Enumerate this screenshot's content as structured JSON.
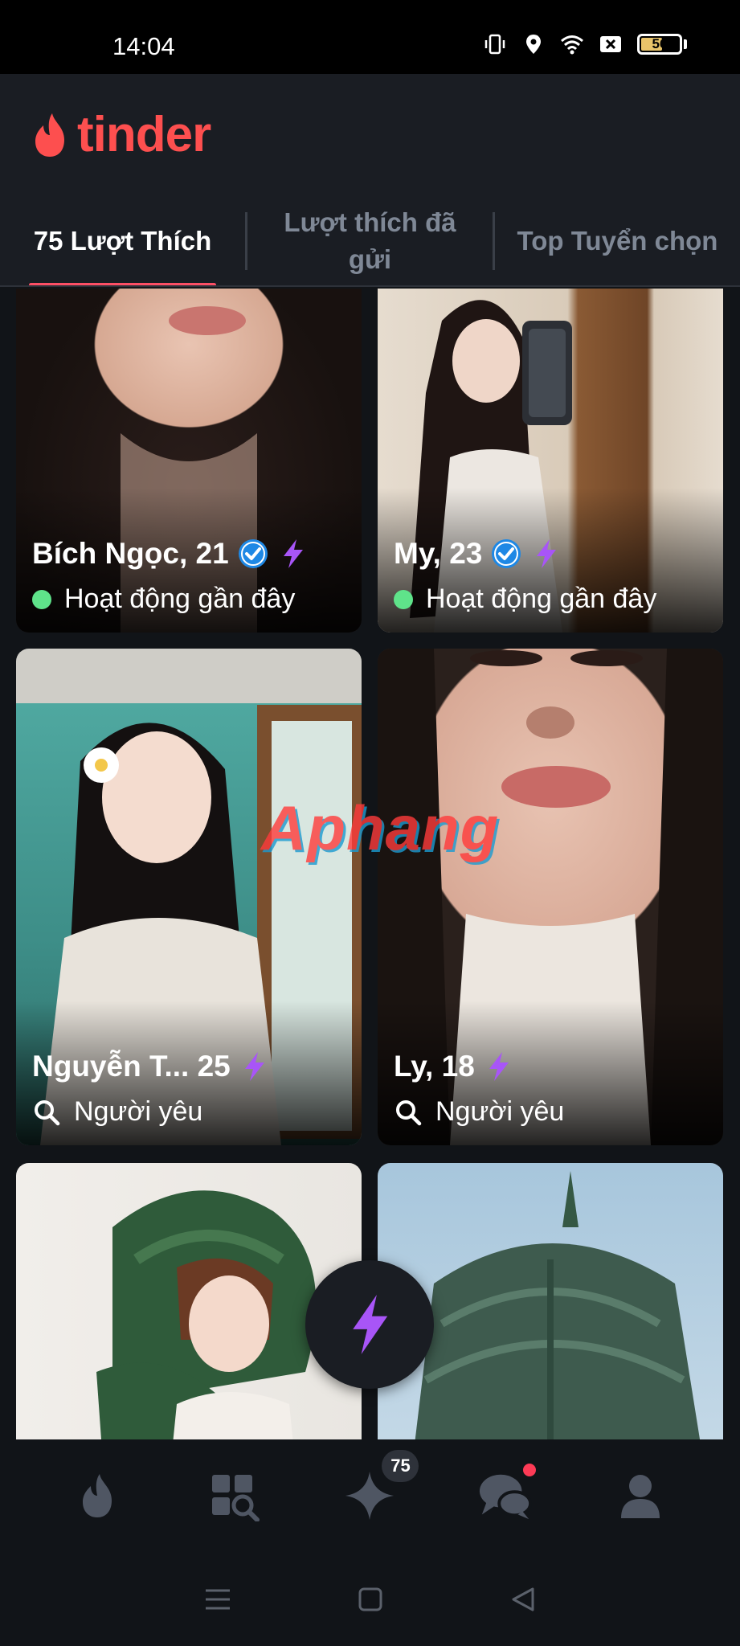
{
  "status_bar": {
    "time": "14:04",
    "icons": [
      "vibrate-icon",
      "location-icon",
      "wifi-icon",
      "close-box-icon"
    ],
    "battery": "56"
  },
  "header": {
    "logo_text": "tinder",
    "tabs": [
      {
        "label": "75 Lượt Thích",
        "active": true
      },
      {
        "label": "Lượt thích đã gửi",
        "active": false
      },
      {
        "label": "Top Tuyển chọn",
        "active": false
      }
    ]
  },
  "cards": [
    {
      "name": "Bích Ngọc, 21",
      "verified": true,
      "boosted": true,
      "status_type": "online",
      "status": "Hoạt động gần đây"
    },
    {
      "name": "My, 23",
      "verified": true,
      "boosted": true,
      "status_type": "online",
      "status": "Hoạt động gần đây"
    },
    {
      "name": "Nguyễn T...  25",
      "verified": false,
      "boosted": true,
      "status_type": "search",
      "status": "Người yêu"
    },
    {
      "name": "Ly, 18",
      "verified": false,
      "boosted": true,
      "status_type": "search",
      "status": "Người yêu"
    },
    {
      "name": "",
      "verified": false,
      "boosted": false,
      "status_type": "none",
      "status": ""
    },
    {
      "name": "",
      "verified": false,
      "boosted": false,
      "status_type": "none",
      "status": ""
    }
  ],
  "watermark": "Aphang",
  "bottom_nav": [
    {
      "icon": "flame-icon"
    },
    {
      "icon": "explore-icon"
    },
    {
      "icon": "likes-star-icon",
      "badge": "75"
    },
    {
      "icon": "chat-icon",
      "has_dot": true
    },
    {
      "icon": "profile-icon"
    }
  ],
  "colors": {
    "brand": "#fd4f4f",
    "tab_underline": "#fd4f65",
    "online": "#5fe38a",
    "boost": "#a855f7",
    "verified": "#1e88e5",
    "background": "#111418"
  }
}
